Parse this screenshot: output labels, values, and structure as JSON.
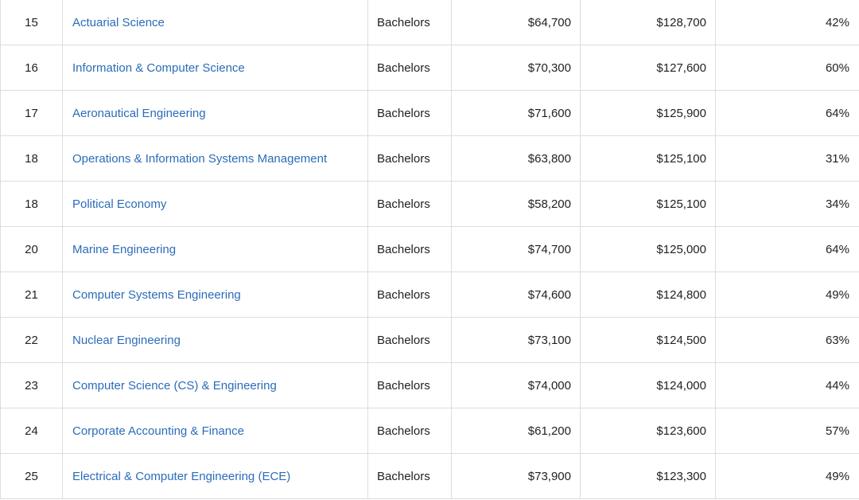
{
  "table": {
    "rows": [
      {
        "rank": "15",
        "major": "Actuarial Science",
        "degree": "Bachelors",
        "early_pay": "$64,700",
        "mid_pay": "$128,700",
        "meaning": "42%"
      },
      {
        "rank": "16",
        "major": "Information & Computer Science",
        "degree": "Bachelors",
        "early_pay": "$70,300",
        "mid_pay": "$127,600",
        "meaning": "60%"
      },
      {
        "rank": "17",
        "major": "Aeronautical Engineering",
        "degree": "Bachelors",
        "early_pay": "$71,600",
        "mid_pay": "$125,900",
        "meaning": "64%"
      },
      {
        "rank": "18",
        "major": "Operations & Information Systems Management",
        "degree": "Bachelors",
        "early_pay": "$63,800",
        "mid_pay": "$125,100",
        "meaning": "31%"
      },
      {
        "rank": "18",
        "major": "Political Economy",
        "degree": "Bachelors",
        "early_pay": "$58,200",
        "mid_pay": "$125,100",
        "meaning": "34%"
      },
      {
        "rank": "20",
        "major": "Marine Engineering",
        "degree": "Bachelors",
        "early_pay": "$74,700",
        "mid_pay": "$125,000",
        "meaning": "64%"
      },
      {
        "rank": "21",
        "major": "Computer Systems Engineering",
        "degree": "Bachelors",
        "early_pay": "$74,600",
        "mid_pay": "$124,800",
        "meaning": "49%"
      },
      {
        "rank": "22",
        "major": "Nuclear Engineering",
        "degree": "Bachelors",
        "early_pay": "$73,100",
        "mid_pay": "$124,500",
        "meaning": "63%"
      },
      {
        "rank": "23",
        "major": "Computer Science (CS) & Engineering",
        "degree": "Bachelors",
        "early_pay": "$74,000",
        "mid_pay": "$124,000",
        "meaning": "44%"
      },
      {
        "rank": "24",
        "major": "Corporate Accounting & Finance",
        "degree": "Bachelors",
        "early_pay": "$61,200",
        "mid_pay": "$123,600",
        "meaning": "57%"
      },
      {
        "rank": "25",
        "major": "Electrical & Computer Engineering (ECE)",
        "degree": "Bachelors",
        "early_pay": "$73,900",
        "mid_pay": "$123,300",
        "meaning": "49%"
      }
    ]
  },
  "colors": {
    "link": "#2b6cb9",
    "text": "#222222",
    "border": "#dddddd"
  }
}
